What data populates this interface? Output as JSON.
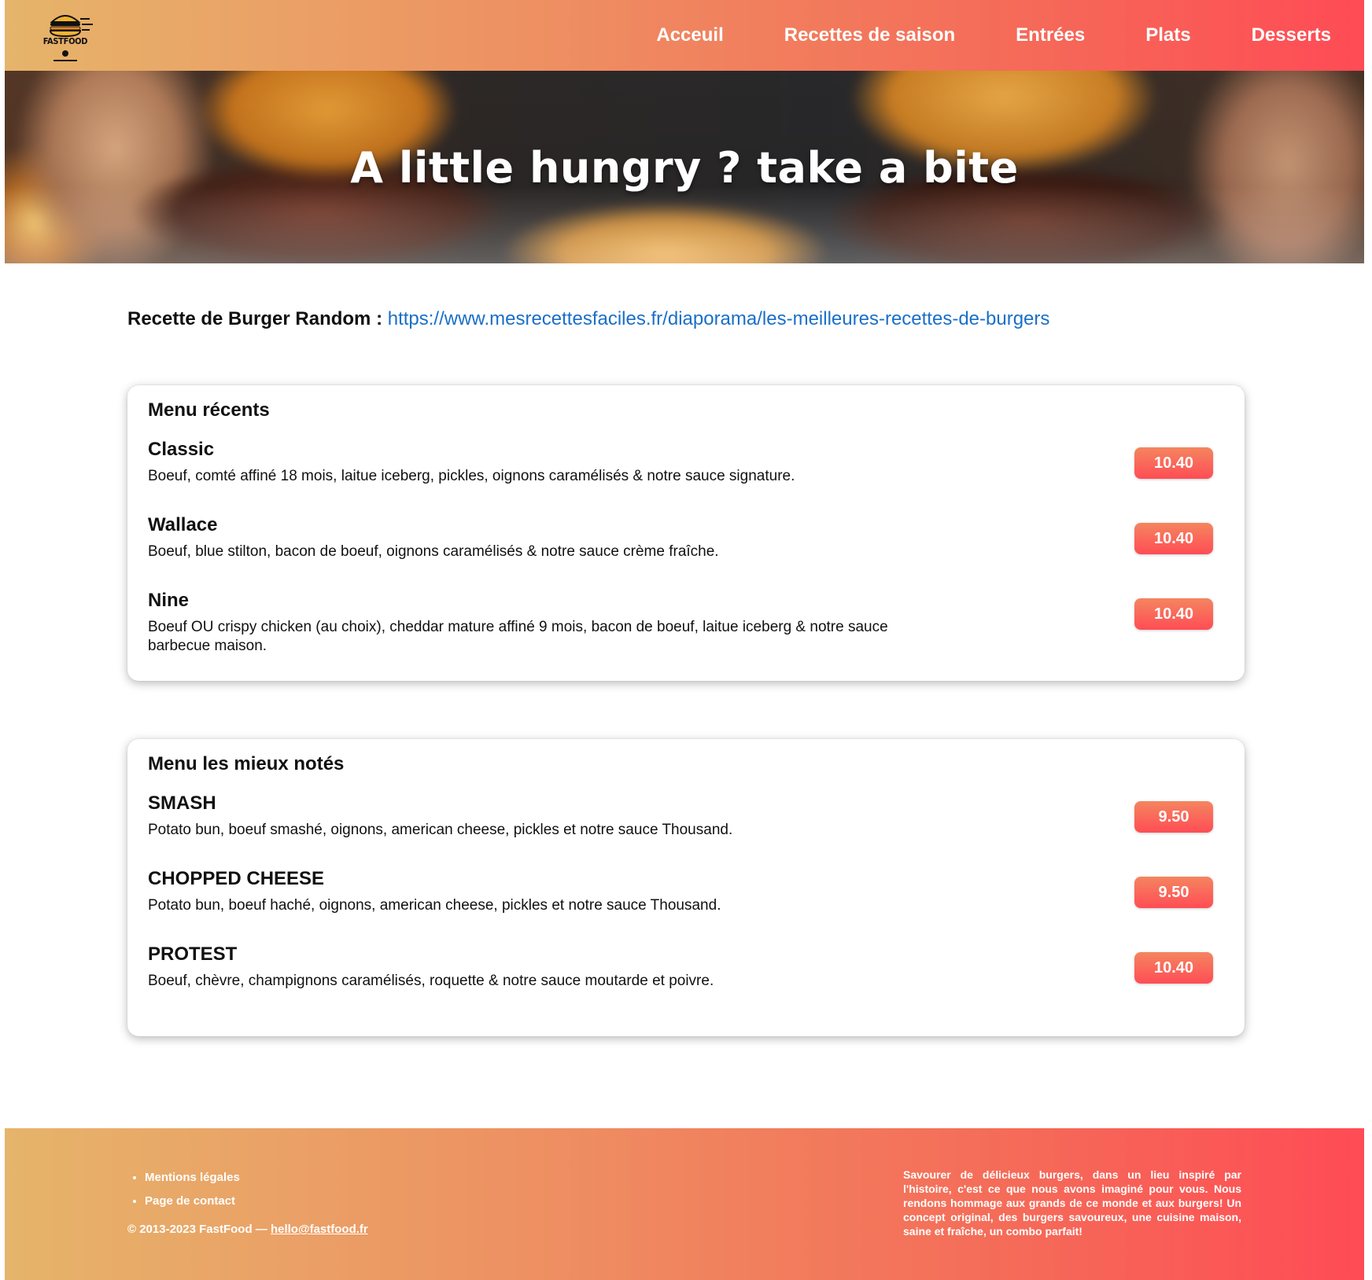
{
  "brand": {
    "logo_text": "FASTFOOD"
  },
  "nav": {
    "items": [
      "Acceuil",
      "Recettes de saison",
      "Entrées",
      "Plats",
      "Desserts"
    ]
  },
  "hero": {
    "title": "A little hungry ? take a bite"
  },
  "random_recipe": {
    "label": "Recette de Burger Random :",
    "url": "https://www.mesrecettesfaciles.fr/diaporama/les-meilleures-recettes-de-burgers"
  },
  "menus": [
    {
      "title": "Menu récents",
      "items": [
        {
          "name": "Classic",
          "desc": "Boeuf, comté affiné 18 mois, laitue iceberg, pickles, oignons caramélisés & notre sauce signature.",
          "price": "10.40"
        },
        {
          "name": "Wallace",
          "desc": "Boeuf, blue stilton, bacon de boeuf, oignons caramélisés & notre sauce crème fraîche.",
          "price": "10.40"
        },
        {
          "name": "Nine",
          "desc": "Boeuf OU crispy chicken (au choix), cheddar mature affiné 9 mois, bacon de boeuf, laitue iceberg & notre sauce barbecue maison.",
          "price": "10.40"
        }
      ]
    },
    {
      "title": "Menu les mieux notés",
      "items": [
        {
          "name": "SMASH",
          "desc": "Potato bun, boeuf smashé, oignons, american cheese, pickles et notre sauce Thousand.",
          "price": "9.50"
        },
        {
          "name": "CHOPPED CHEESE",
          "desc": "Potato bun, boeuf haché, oignons, american cheese, pickles et notre sauce Thousand.",
          "price": "9.50"
        },
        {
          "name": "PROTEST",
          "desc": "Boeuf, chèvre, champignons caramélisés, roquette & notre sauce moutarde et poivre.",
          "price": "10.40"
        }
      ]
    }
  ],
  "footer": {
    "links": [
      "Mentions légales",
      "Page de contact"
    ],
    "copyright": "© 2013-2023 FastFood — ",
    "email": "hello@fastfood.fr",
    "blurb": "Savourer de délicieux burgers, dans un lieu inspiré par l'histoire, c'est ce que nous avons imaginé pour vous. Nous rendons hommage aux grands de ce monde et aux burgers! Un concept original, des burgers savoureux, une cuisine maison, saine et fraîche, un combo parfait!"
  },
  "colors": {
    "gradient_start": "#e6b46a",
    "gradient_end": "#ff4b55",
    "link": "#1a6fc8",
    "price_badge": "#ff4d55"
  }
}
